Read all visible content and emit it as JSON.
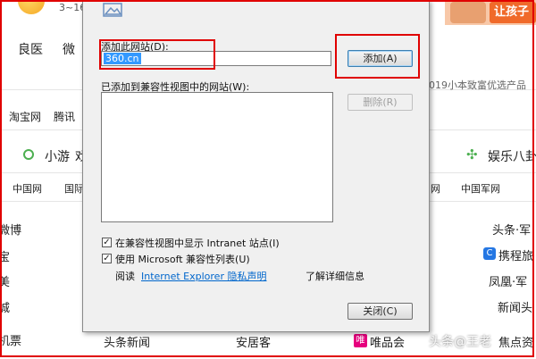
{
  "background": {
    "top_left_date": "3~16",
    "banner_right_text": "让孩子",
    "nav_items": [
      "良医",
      "微"
    ],
    "tabs": [
      "淘宝网",
      "腾讯"
    ],
    "promo_text": "019小本致富优选产品",
    "games_label": "小游",
    "games_label2": "戏",
    "ent_label": "娱乐八卦",
    "links_row": [
      "中国网",
      "国际"
    ],
    "links_row_right": [
      "网",
      "中国军网"
    ],
    "left_col": [
      "微博",
      "宝",
      "美",
      "城",
      "机票"
    ],
    "right_col": [
      "头条·军",
      "携程旅",
      "凤凰·军",
      "新闻头",
      "焦点资"
    ],
    "bottom_row": [
      "头条新闻",
      "安居客",
      "唯品会"
    ],
    "watermark": "头条@王老"
  },
  "dialog": {
    "add_site_label": "添加此网站(D):",
    "site_input_value": "360.cn",
    "add_button": "添加(A)",
    "list_label": "已添加到兼容性视图中的网站(W):",
    "delete_button": "删除(R)",
    "checkbox1_label": "在兼容性视图中显示 Intranet 站点(I)",
    "checkbox2_label": "使用 Microsoft 兼容性列表(U)",
    "read_prefix": "阅读",
    "privacy_link": "Internet Explorer 隐私声明",
    "read_suffix": "了解详细信息",
    "close_button": "关闭(C)"
  },
  "colors": {
    "annotation_red": "#e00000",
    "link_blue": "#0066cc",
    "dialog_bg": "#f0f0f0",
    "selection_blue": "#3399ff"
  }
}
